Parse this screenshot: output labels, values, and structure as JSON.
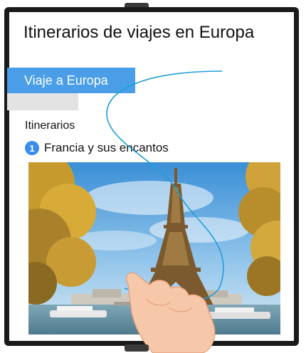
{
  "page": {
    "title": "Itinerarios de viajes en Europa"
  },
  "tab": {
    "label": "Viaje a Europa"
  },
  "section": {
    "heading": "Itinerarios"
  },
  "items": [
    {
      "number": "1",
      "label": "Francia y sus encantos"
    }
  ],
  "colors": {
    "accent": "#4a9ee8",
    "badge": "#3a8eea",
    "frame": "#1a1a1a",
    "gesture_line": "#1e9fd8"
  },
  "icons": {
    "gesture": "hand-gesture-icon",
    "photo": "eiffel-tower-photo"
  }
}
